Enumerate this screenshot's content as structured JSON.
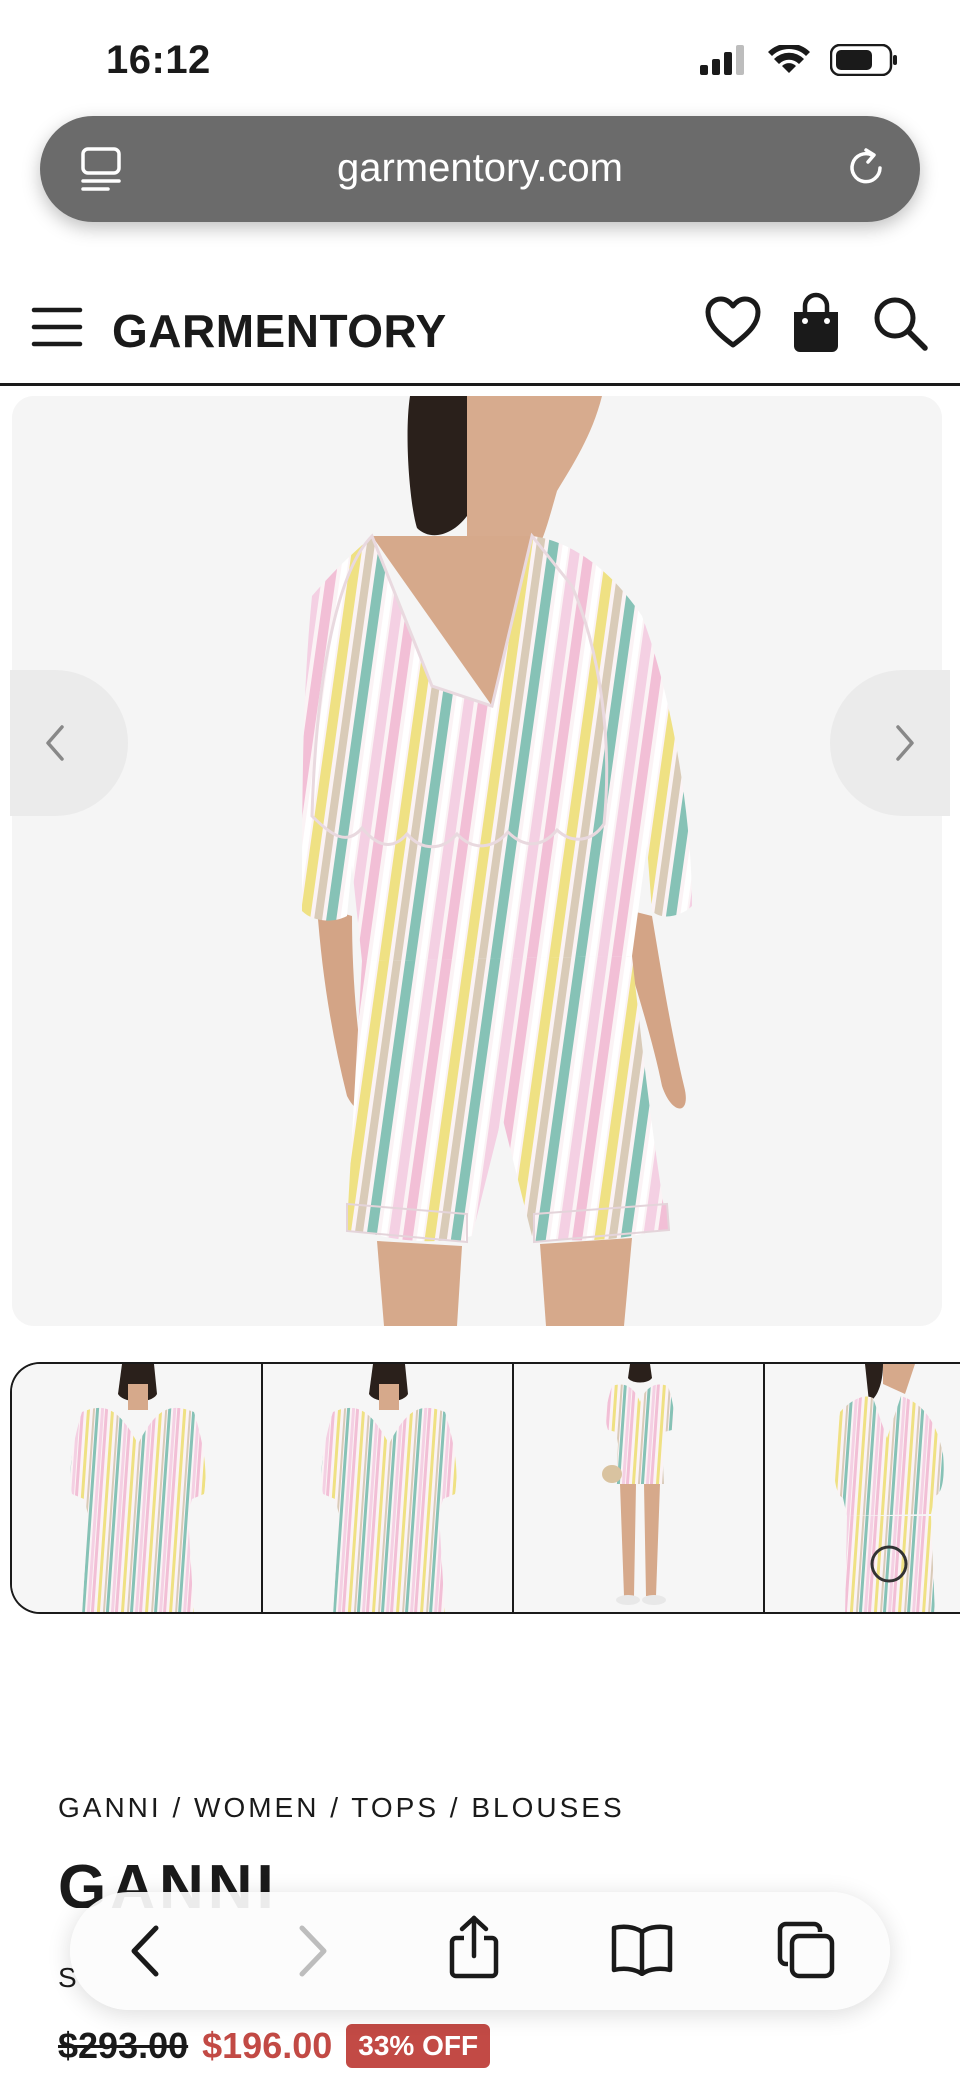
{
  "status_bar": {
    "time": "16:12"
  },
  "browser": {
    "url": "garmentory.com"
  },
  "site": {
    "logo": "GARMENTORY"
  },
  "icons": {
    "status": [
      "signal-icon",
      "wifi-icon",
      "battery-icon"
    ],
    "address_bar": [
      "tabs-icon",
      "reload-icon"
    ],
    "header": [
      "menu-icon",
      "heart-icon",
      "bag-icon",
      "search-icon"
    ],
    "toolbar": [
      "back-icon",
      "forward-icon",
      "share-icon",
      "bookmarks-icon",
      "tabs-icon"
    ]
  },
  "gallery": {
    "thumbnail_count": 4,
    "main_image": "striped blouse and shorts, back view"
  },
  "product": {
    "breadcrumb": "GANNI / WOMEN / TOPS / BLOUSES",
    "brand": "GANNI",
    "title": "S",
    "price_original": "$293.00",
    "price_sale": "$196.00",
    "discount": "33% OFF"
  },
  "colors": {
    "sale": "#c24a45",
    "address_bar": "#6b6b6b",
    "stripe_pink": "#f1c6da",
    "stripe_yellow": "#f0e58a",
    "stripe_teal": "#7fbfb3"
  }
}
